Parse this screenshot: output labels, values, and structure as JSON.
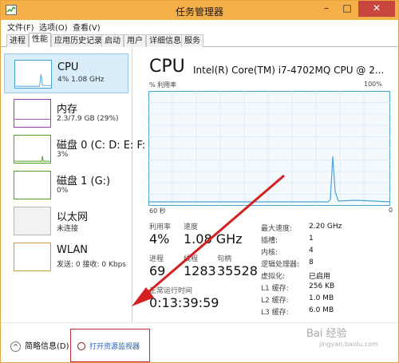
{
  "window": {
    "title": "任务管理器",
    "min_glyph": "–",
    "max_glyph": "□",
    "close_glyph": "✕",
    "accent_color": "#f6b04a",
    "close_color": "#c7463d"
  },
  "menu": {
    "items": [
      "文件(F)",
      "选项(O)",
      "查看(V)"
    ]
  },
  "tabs": [
    "进程",
    "性能",
    "应用历史记录",
    "启动",
    "用户",
    "详细信息",
    "服务"
  ],
  "active_tab": "性能",
  "resources": [
    {
      "name": "CPU",
      "sub": "4% 1.08 GHz",
      "color": "#4aa3d8",
      "selected": true
    },
    {
      "name": "内存",
      "sub": "2.3/7.9 GB (29%)",
      "color": "#9b3bb5",
      "selected": false
    },
    {
      "name": "磁盘 0 (C: D: E: F:",
      "sub": "3%",
      "color": "#4fa32b",
      "selected": false
    },
    {
      "name": "磁盘 1 (G:)",
      "sub": "0%",
      "color": "#4fa32b",
      "selected": false
    },
    {
      "name": "以太网",
      "sub": "未连接",
      "color": "#c8a043",
      "selected": false
    },
    {
      "name": "WLAN",
      "sub": "发送: 0 接收: 0 Kbps",
      "color": "#c8a043",
      "selected": false
    }
  ],
  "cpu": {
    "title": "CPU",
    "model": "Intel(R) Core(TM) i7-4702MQ CPU @ 2...",
    "graph_label_left": "% 利用率",
    "graph_label_right": "100%",
    "x_left": "60 秒",
    "x_right": "0",
    "utilization_label": "利用率",
    "utilization": "4%",
    "speed_label": "速度",
    "speed": "1.08 GHz",
    "processes_label": "进程",
    "processes": "69",
    "threads_label": "线程",
    "threads": "1283",
    "handles_label": "句柄",
    "handles": "35528",
    "uptime_label": "正常运行时间",
    "uptime": "0:13:39:59",
    "details": [
      {
        "key": "最大速度:",
        "value": "2.20 GHz"
      },
      {
        "key": "插槽:",
        "value": "1"
      },
      {
        "key": "内核:",
        "value": "4"
      },
      {
        "key": "逻辑处理器:",
        "value": "8"
      },
      {
        "key": "虚拟化:",
        "value": "已启用"
      },
      {
        "key": "L1 缓存:",
        "value": "256 KB"
      },
      {
        "key": "L2 缓存:",
        "value": "1.0 MB"
      },
      {
        "key": "L3 缓存:",
        "value": "6.0 MB"
      }
    ]
  },
  "footer": {
    "fewer_details": "简略信息(D)",
    "chevron_glyph": "^",
    "open_monitor": "打开资源监视器"
  },
  "watermark": {
    "main": "Bai 经验",
    "sub": "jingyan.baidu.com"
  }
}
